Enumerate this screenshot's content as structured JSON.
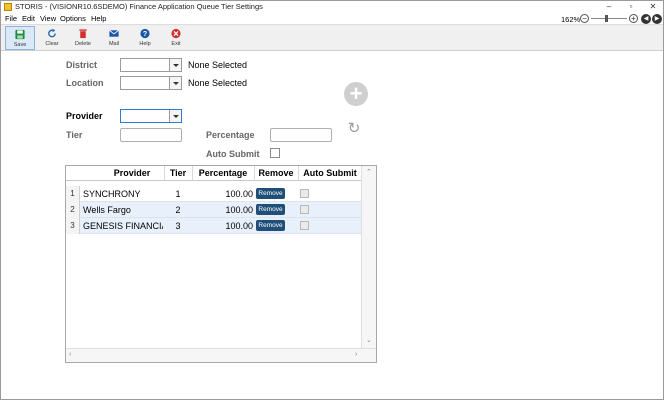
{
  "window": {
    "title": "STORIS - (VISIONR10.6SDEMO) Finance Application Queue Tier Settings",
    "controls": [
      "–",
      "▫",
      "✕"
    ]
  },
  "menu": {
    "items": [
      "File",
      "Edit",
      "View",
      "Options",
      "Help"
    ],
    "zoom": "162%"
  },
  "toolbar": {
    "buttons": [
      {
        "label": "Save",
        "icon": "save-icon",
        "color": "#1e8c3a"
      },
      {
        "label": "Clear",
        "icon": "refresh-icon",
        "color": "#2b6cb0"
      },
      {
        "label": "Delete",
        "icon": "trash-icon",
        "color": "#d32f2f"
      },
      {
        "label": "Mail",
        "icon": "mail-icon",
        "color": "#1a56a8"
      },
      {
        "label": "Help",
        "icon": "help-icon",
        "color": "#1a56a8"
      },
      {
        "label": "Exit",
        "icon": "close-icon",
        "color": "#d32f2f"
      }
    ]
  },
  "form": {
    "district": {
      "label": "District",
      "value": "None Selected"
    },
    "location": {
      "label": "Location",
      "value": "None Selected"
    },
    "provider": {
      "label": "Provider"
    },
    "tier": {
      "label": "Tier"
    },
    "percentage": {
      "label": "Percentage"
    },
    "auto_submit": {
      "label": "Auto Submit",
      "checked": false
    }
  },
  "grid": {
    "columns": [
      "Provider",
      "Tier",
      "Percentage",
      "Remove",
      "Auto Submit"
    ],
    "rows": [
      {
        "num": "1",
        "provider": "SYNCHRONY",
        "tier": "1",
        "percentage": "100.00",
        "remove": "Remove",
        "auto_submit": false
      },
      {
        "num": "2",
        "provider": "Wells Fargo",
        "tier": "2",
        "percentage": "100.00",
        "remove": "Remove",
        "auto_submit": false
      },
      {
        "num": "3",
        "provider": "GENESIS FINANCIAL",
        "tier": "3",
        "percentage": "100.00",
        "remove": "Remove",
        "auto_submit": false
      }
    ]
  }
}
